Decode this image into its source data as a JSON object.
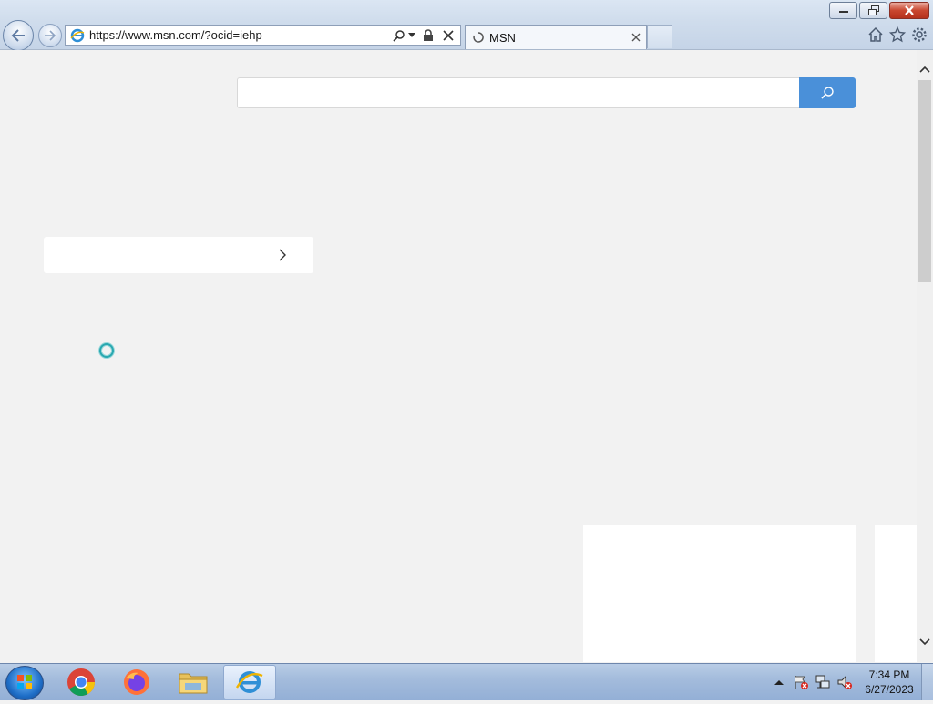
{
  "browser": {
    "address_url": "https://www.msn.com/?ocid=iehp",
    "tab_title": "MSN",
    "toolbar_icons": [
      "home-icon",
      "favorites-icon",
      "settings-gear-icon"
    ]
  },
  "page": {
    "search": {
      "placeholder": "",
      "button_icon": "search-icon",
      "accent_color": "#4a90d9"
    },
    "loading": true
  },
  "taskbar": {
    "pinned": [
      "Google Chrome",
      "Firefox",
      "File Explorer",
      "Internet Explorer"
    ],
    "clock": {
      "time": "7:34 PM",
      "date": "6/27/2023"
    }
  }
}
